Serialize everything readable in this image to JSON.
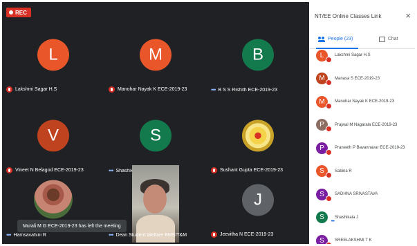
{
  "rec_label": "REC",
  "grid": [
    {
      "name": "Lakshmi Sagar H.S",
      "initial": "L",
      "color": "#e8562a",
      "status": "muted",
      "col": 0,
      "row": 0
    },
    {
      "name": "Manohar Nayak K ECE-2019-23",
      "initial": "M",
      "color": "#e8562a",
      "status": "muted",
      "col": 1,
      "row": 0
    },
    {
      "name": "B S S Rishith ECE-2019-23",
      "initial": "B",
      "color": "#137a4e",
      "status": "speaking",
      "col": 2,
      "row": 0
    },
    {
      "name": "Vineet N Belagod ECE-2019-23",
      "initial": "V",
      "color": "#c0431f",
      "status": "muted",
      "col": 0,
      "row": 1
    },
    {
      "name": "Shashikala J",
      "initial": "S",
      "color": "#137a4e",
      "status": "speaking",
      "col": 1,
      "row": 1
    },
    {
      "name": "Sushant Gupta ECE-2019-23",
      "initial": "",
      "color": "flower",
      "status": "muted",
      "col": 2,
      "row": 1
    },
    {
      "name": "Hamsavahini R",
      "initial": "",
      "color": "photo",
      "status": "speaking",
      "col": 0,
      "row": 2
    },
    {
      "name": "Dean Student Welfare BMSIT&M",
      "initial": "",
      "color": "camera",
      "status": "speaking",
      "col": 1,
      "row": 2
    },
    {
      "name": "Jeevitha N ECE-2019-23",
      "initial": "J",
      "color": "#5f6368",
      "status": "muted",
      "col": 2,
      "row": 2
    }
  ],
  "toast": "Murali M G ECE-2019-23 has left the meeting",
  "panel": {
    "title": "NT/EE Online Classes Link",
    "close_icon": "close-icon",
    "tabs": {
      "people": "People (23)",
      "chat": "Chat"
    },
    "people": [
      {
        "name": "Lakshmi Sagar H.S",
        "initial": "L",
        "color": "#e8562a",
        "status": "muted"
      },
      {
        "name": "Manasa S ECE-2019-23",
        "initial": "M",
        "color": "#c0431f",
        "status": "muted"
      },
      {
        "name": "Manohar Nayak K ECE-2019-23",
        "initial": "M",
        "color": "#e8562a",
        "status": "muted"
      },
      {
        "name": "Prajwal M Nagarala ECE-2019-23",
        "initial": "P",
        "color": "#8d6e63",
        "status": "muted"
      },
      {
        "name": "Praneeth P Bavannavar ECE-2019-23",
        "initial": "P",
        "color": "#7b1fa2",
        "status": "muted"
      },
      {
        "name": "Sabina R",
        "initial": "S",
        "color": "#e8562a",
        "status": "muted"
      },
      {
        "name": "SADHNA SRIVASTAVA",
        "initial": "S",
        "color": "#7b1fa2",
        "status": "muted"
      },
      {
        "name": "Shashikala J",
        "initial": "S",
        "color": "#137a4e",
        "status": "speaking"
      },
      {
        "name": "SREELAKSHMI T K",
        "initial": "S",
        "color": "#7b1fa2",
        "status": "muted"
      }
    ]
  }
}
